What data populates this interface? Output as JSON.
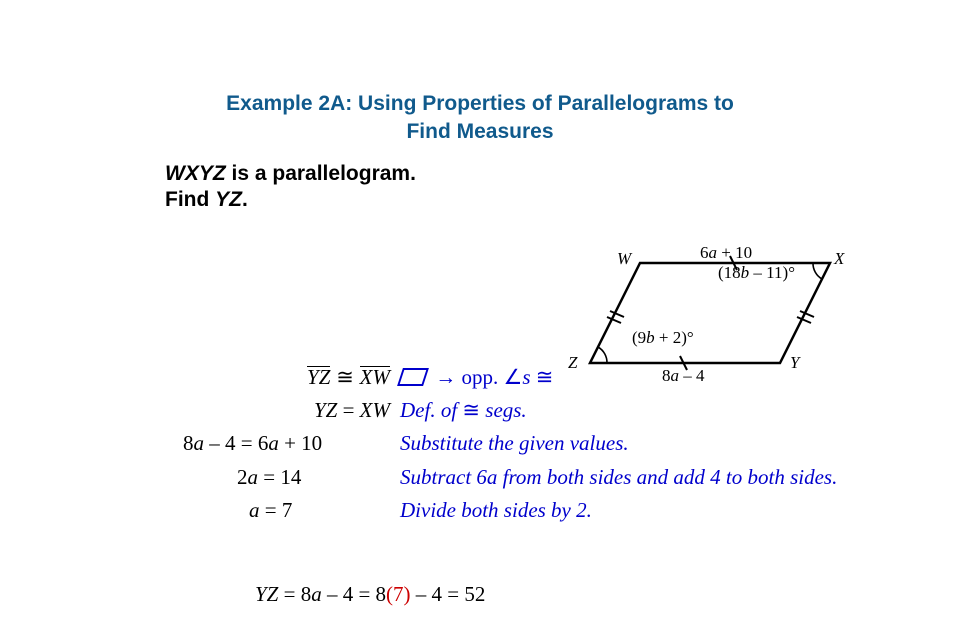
{
  "title_line1": "Example 2A: Using Properties of Parallelograms to",
  "title_line2": "Find Measures",
  "prompt_bold1": "WXYZ",
  "prompt_rest1": " is a parallelogram.",
  "prompt_line2a": "Find ",
  "prompt_line2b": "YZ",
  "prompt_line2c": ".",
  "figure": {
    "W": "W",
    "X": "X",
    "Y": "Y",
    "Z": "Z",
    "top_side_a": "6",
    "top_side_b": "a",
    "top_side_c": " + 10",
    "bottom_side_a": "8",
    "bottom_side_b": "a",
    "bottom_side_c": " – 4",
    "angX_a": "(18",
    "angX_b": "b",
    "angX_c": " – 11)°",
    "angZ_a": "(9",
    "angZ_b": "b",
    "angZ_c": " + 2)°"
  },
  "proof": {
    "r1": {
      "lhs_a": "YZ",
      "cong": " ≅ ",
      "lhs_b": "XW",
      "reason_arrow": " → opp. ",
      "reason_ang": "∠",
      "reason_s": "s ",
      "reason_cong": "≅"
    },
    "r2": {
      "stmt_a": "YZ",
      "stmt_eq": " = ",
      "stmt_b": "XW",
      "reason_a": "Def. of ",
      "reason_cong": "≅",
      "reason_b": " segs."
    },
    "r3": {
      "stmt_a": "8",
      "stmt_b": "a",
      "stmt_c": " – 4  = 6",
      "stmt_d": "a",
      "stmt_e": " + 10",
      "reason": "Substitute the given values."
    },
    "r4": {
      "stmt_a": "2",
      "stmt_b": "a",
      "stmt_c": " = 14",
      "reason_a": "Subtract 6",
      "reason_b": "a",
      "reason_c": " from both sides and add 4 to both sides."
    },
    "r5": {
      "stmt_a": "a",
      "stmt_b": " = 7",
      "reason": "Divide both sides by 2."
    }
  },
  "final": {
    "a": "YZ",
    "b": " = 8",
    "c": "a",
    "d": " – 4 = 8",
    "e": "(7)",
    "f": " – 4 = 52"
  }
}
